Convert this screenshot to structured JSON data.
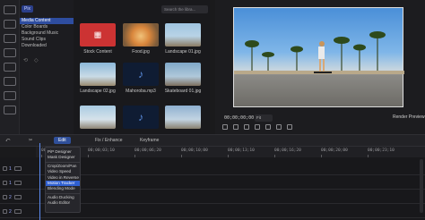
{
  "tree": {
    "badge": "Pix",
    "items": [
      "Media Content",
      "Color Boards",
      "Background Music",
      "Sound Clips",
      "Downloaded"
    ],
    "selected_index": 0
  },
  "search": {
    "placeholder": "Search the libra..."
  },
  "media": [
    {
      "label": "Stock Content",
      "style": "t-stock",
      "icon": "media-library-icon"
    },
    {
      "label": "Food.jpg",
      "style": "t-food"
    },
    {
      "label": "Landscape 01.jpg",
      "style": "t-land1"
    },
    {
      "label": "Landscape 02.jpg",
      "style": "t-land2"
    },
    {
      "label": "Mahoroba.mp3",
      "style": "t-music",
      "icon": "music-note-icon"
    },
    {
      "label": "Skateboard 01.jpg",
      "style": "t-skate"
    },
    {
      "label": "",
      "style": "t-land3"
    },
    {
      "label": "",
      "style": "t-music",
      "icon": "music-note-icon"
    },
    {
      "label": "",
      "style": "t-land4"
    }
  ],
  "preview": {
    "timecode": "00;00;00;00",
    "fit": "Fit",
    "render_label": "Render Preview"
  },
  "toolbar": {
    "tab1": "Edit",
    "tab2": "Fix / Enhance",
    "tab3": "Keyframe"
  },
  "ruler": [
    "00;00;00;00",
    "00;00;03;10",
    "00;00;06;20",
    "00;00;10;00",
    "00;00;13;10",
    "00;00;16;20",
    "00;00;20;00",
    "00;00;23;10"
  ],
  "tracks": [
    "1",
    "1",
    "2",
    "2"
  ],
  "menu": {
    "items": [
      "PiP Designer",
      "Mask Designer",
      "Crop/Zoom/Pan",
      "Video Speed",
      "Video in Reverse",
      "Motion Tracker",
      "Blending Mode",
      "Audio Ducking",
      "Audio Editor"
    ],
    "selected_index": 5
  },
  "colors": {
    "accent": "#2f5fd0"
  }
}
